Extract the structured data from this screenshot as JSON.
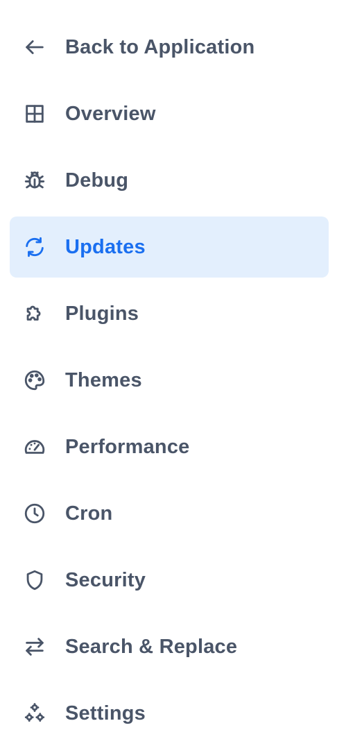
{
  "sidebar": {
    "items": [
      {
        "label": "Back to Application",
        "icon": "arrow-left-icon"
      },
      {
        "label": "Overview",
        "icon": "grid-icon"
      },
      {
        "label": "Debug",
        "icon": "bug-icon"
      },
      {
        "label": "Updates",
        "icon": "refresh-icon",
        "active": true
      },
      {
        "label": "Plugins",
        "icon": "puzzle-icon"
      },
      {
        "label": "Themes",
        "icon": "palette-icon"
      },
      {
        "label": "Performance",
        "icon": "gauge-icon"
      },
      {
        "label": "Cron",
        "icon": "clock-icon"
      },
      {
        "label": "Security",
        "icon": "shield-icon"
      },
      {
        "label": "Search & Replace",
        "icon": "arrows-swap-icon"
      },
      {
        "label": "Settings",
        "icon": "gears-icon"
      }
    ]
  },
  "colors": {
    "text": "#4a5568",
    "active_text": "#1a6ff0",
    "active_bg": "#e3effd"
  }
}
